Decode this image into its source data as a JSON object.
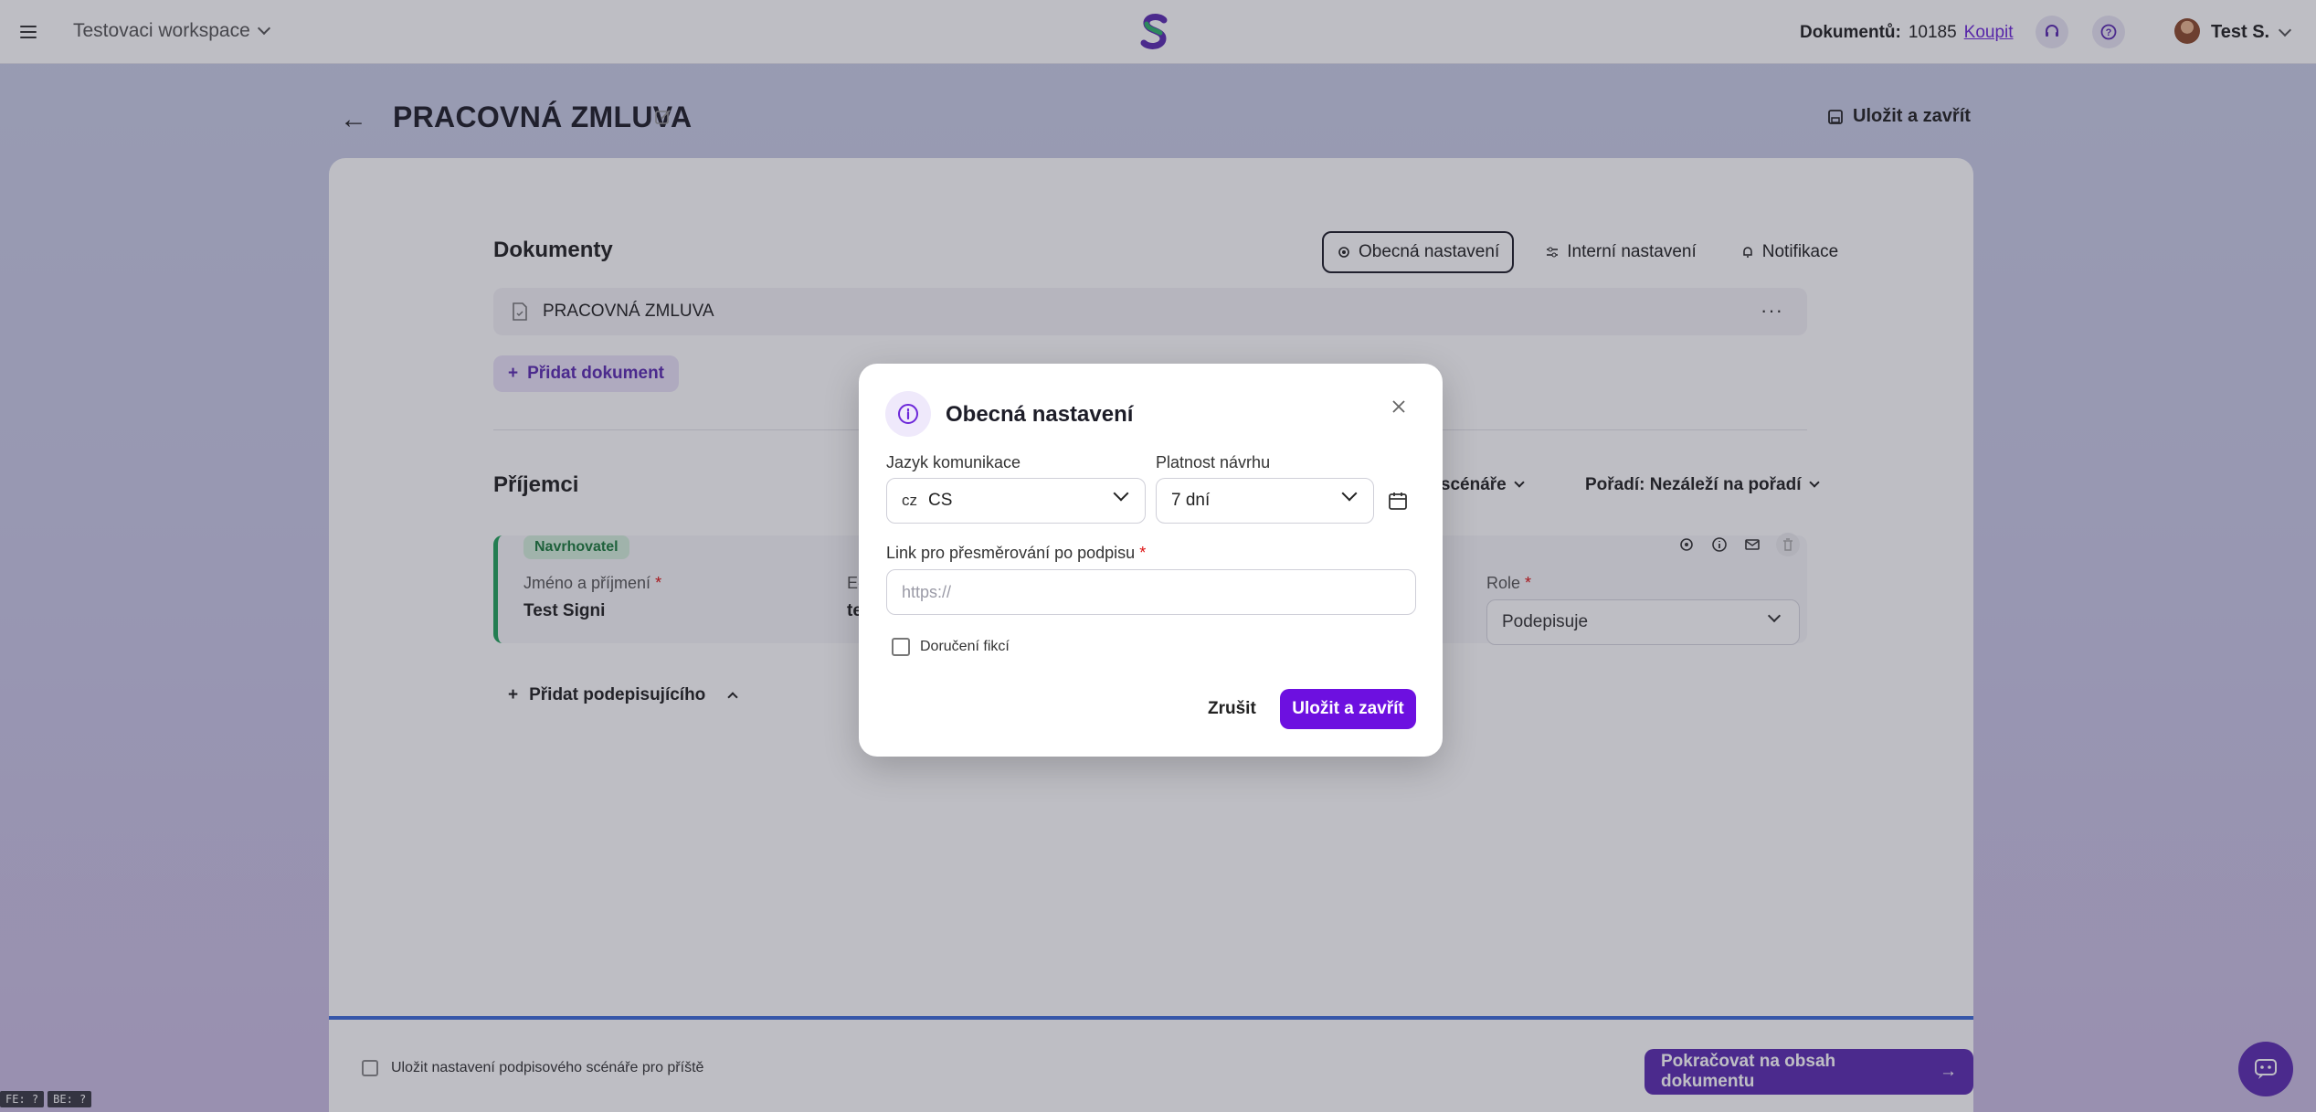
{
  "topbar": {
    "workspace": "Testovaci workspace",
    "doc_label": "Dokumentů:",
    "doc_count": "10185",
    "buy_label": "Koupit",
    "user_name": "Test S."
  },
  "header": {
    "title": "PRACOVNÁ ZMLUVA",
    "save_close": "Uložit a zavřít"
  },
  "documents": {
    "section_title": "Dokumenty",
    "tabs": [
      "Obecná nastavení",
      "Interní nastavení",
      "Notifikace"
    ],
    "items": [
      "PRACOVNÁ ZMLUVA"
    ],
    "add_label": "Přidat dokument"
  },
  "recipients": {
    "section_title": "Příjemci",
    "scenario_label": "o scénáře",
    "order_label": "Pořadí: Nezáleží na pořadí",
    "badge": "Navrhovatel",
    "name_label": "Jméno a příjmení",
    "name_value": "Test Signi",
    "email_label": "E-",
    "email_value": "te",
    "role_label": "Role",
    "role_value": "Podepisuje",
    "add_signer": "Přidat podepisujícího"
  },
  "footer": {
    "save_settings_label": "Uložit nastavení podpisového scénáře pro příště",
    "continue_label": "Pokračovat na obsah dokumentu"
  },
  "debug": [
    "FE: ?",
    "BE: ?"
  ],
  "modal": {
    "title": "Obecná nastavení",
    "language_label": "Jazyk komunikace",
    "language_flag": "cz",
    "language_value": "CS",
    "validity_label": "Platnost návrhu",
    "validity_value": "7 dní",
    "redirect_label": "Link pro přesměrování po podpisu",
    "redirect_placeholder": "https://",
    "fiction_label": "Doručení fikcí",
    "cancel_label": "Zrušit",
    "save_label": "Uložit a zavřít"
  },
  "colors": {
    "accent": "#6d10e0",
    "accent_dark": "#5b2bb0",
    "success": "#22a35b"
  }
}
